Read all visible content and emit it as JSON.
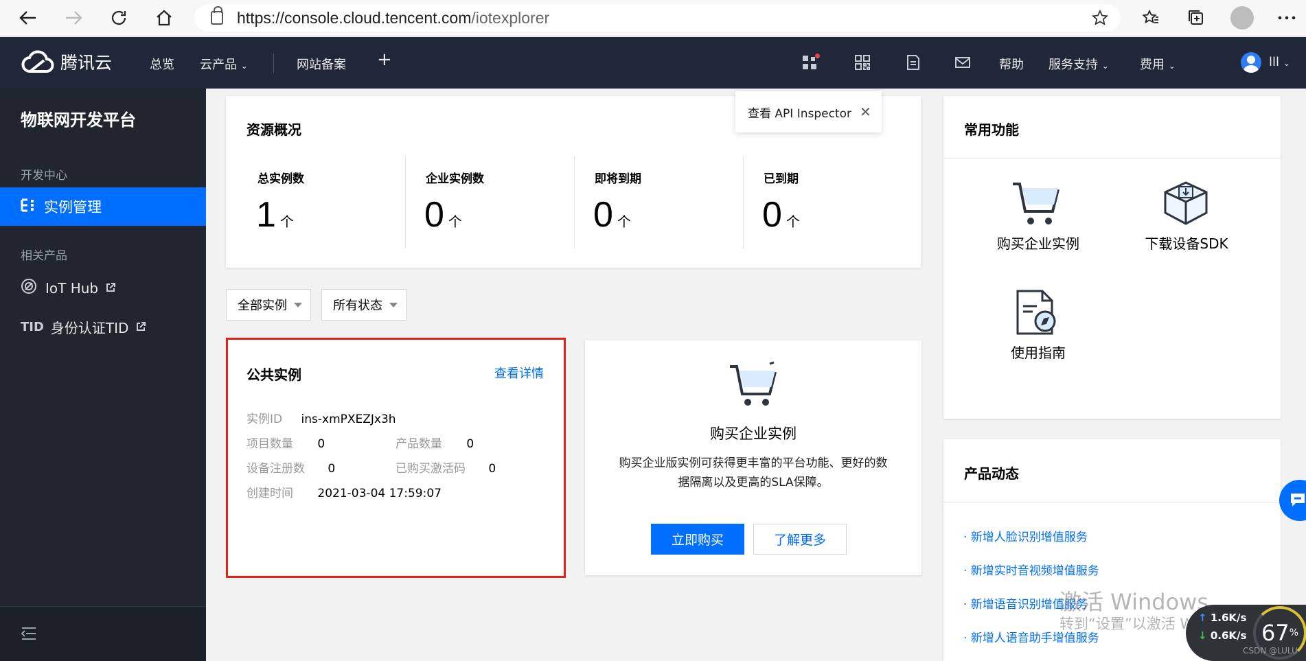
{
  "browser": {
    "url_host": "https://console.cloud.tencent.com",
    "url_path": "/iotexplorer"
  },
  "topnav": {
    "logo_text": "腾讯云",
    "overview": "总览",
    "products": "云产品",
    "beian": "网站备案",
    "plus": "+",
    "help": "帮助",
    "support": "服务支持",
    "billing": "费用",
    "user": "lll"
  },
  "tooltip": {
    "text": "查看 API Inspector",
    "close": "✕"
  },
  "sidebar": {
    "title": "物联网开发平台",
    "section_dev": "开发中心",
    "active_item": "实例管理",
    "section_related": "相关产品",
    "iot_hub": "IoT Hub",
    "tid": "身份认证TID"
  },
  "resources": {
    "title": "资源概况",
    "stats": [
      {
        "label": "总实例数",
        "value": "1",
        "unit": "个"
      },
      {
        "label": "企业实例数",
        "value": "0",
        "unit": "个"
      },
      {
        "label": "即将到期",
        "value": "0",
        "unit": "个"
      },
      {
        "label": "已到期",
        "value": "0",
        "unit": "个"
      }
    ]
  },
  "filters": {
    "instances": "全部实例",
    "status": "所有状态"
  },
  "public_instance": {
    "title": "公共实例",
    "detail_link": "查看详情",
    "id_label": "实例ID",
    "id_value": "ins-xmPXEZJx3h",
    "project_label": "项目数量",
    "project_value": "0",
    "product_label": "产品数量",
    "product_value": "0",
    "device_label": "设备注册数",
    "device_value": "0",
    "code_label": "已购买激活码",
    "code_value": "0",
    "created_label": "创建时间",
    "created_value": "2021-03-04 17:59:07"
  },
  "buy_card": {
    "title": "购买企业实例",
    "desc_line1": "购买企业版实例可获得更丰富的平台功能、更好的数",
    "desc_line2": "据隔离以及更高的SLA保障。",
    "buy_button": "立即购买",
    "learn_button": "了解更多"
  },
  "common": {
    "title": "常用功能",
    "buy_instance": "购买企业实例",
    "download_sdk": "下载设备SDK",
    "guide": "使用指南"
  },
  "news": {
    "title": "产品动态",
    "items": [
      "· 新增人脸识别增值服务",
      "· 新增实时音视频增值服务",
      "· 新增语音识别增值服务",
      "· 新增人语音助手增值服务"
    ]
  },
  "overlay": {
    "watermark_line1": "激活 Windows",
    "watermark_line2": "转到“设置”以激活 Windows。",
    "net_up": "1.6K/s",
    "net_down": "0.6K/s",
    "cpu": "67",
    "cpu_unit": "%",
    "csdn": "CSDN @LULU"
  },
  "colors": {
    "primary": "#006eff",
    "nav_bg": "#1f2738",
    "sidebar_bg": "#20252f",
    "highlight_border": "#e0221c"
  }
}
